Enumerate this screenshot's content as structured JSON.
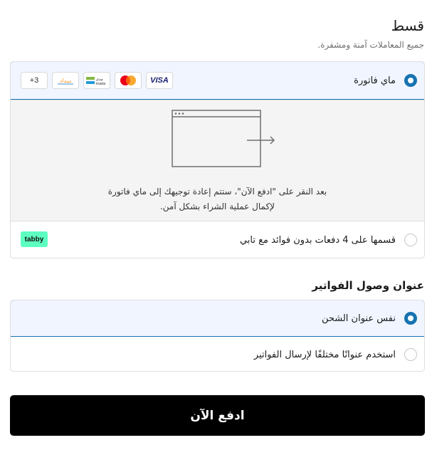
{
  "payment": {
    "title": "قسط",
    "subtitle": "جميع المعاملات آمنة ومشفرة.",
    "myfatoorah_label": "ماي فاتورة",
    "cards": {
      "visa": "VISA",
      "mada_text": "مدى",
      "sadad": "سداد",
      "more": "+3"
    },
    "redirect_line1": "بعد النقر على \"ادفع الآن\"، ستتم إعادة توجيهك إلى ماي فاتورة",
    "redirect_line2": "لإكمال عملية الشراء بشكل آمن.",
    "tabby_label": "قسمها على 4 دفعات بدون فوائد مع تابي",
    "tabby_logo": "tabby"
  },
  "billing": {
    "title": "عنوان وصول الفواتير",
    "same_address": "نفس عنوان الشحن",
    "different_address": "استخدم عنوانًا مختلفًا لإرسال الفواتير"
  },
  "pay_button": "ادفع الآن",
  "colors": {
    "accent": "#1773b0",
    "selected_bg": "#f0f5ff",
    "tabby_green": "#5dffc1",
    "button_bg": "#000000"
  }
}
